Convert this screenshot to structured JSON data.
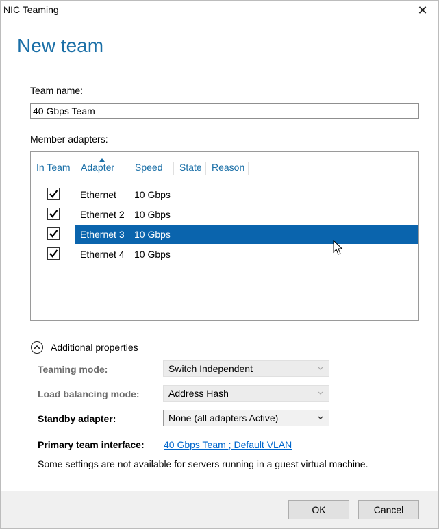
{
  "window": {
    "title": "NIC Teaming",
    "close_symbol": "✕"
  },
  "heading": "New team",
  "team_name": {
    "label": "Team name:",
    "value": "40 Gbps Team"
  },
  "member_adapters": {
    "label": "Member adapters:",
    "columns": [
      "In Team",
      "Adapter",
      "Speed",
      "State",
      "Reason"
    ],
    "sorted_column": "Adapter",
    "rows": [
      {
        "in_team": true,
        "adapter": "Ethernet",
        "speed": "10 Gbps",
        "state": "",
        "reason": "",
        "selected": false
      },
      {
        "in_team": true,
        "adapter": "Ethernet 2",
        "speed": "10 Gbps",
        "state": "",
        "reason": "",
        "selected": false
      },
      {
        "in_team": true,
        "adapter": "Ethernet 3",
        "speed": "10 Gbps",
        "state": "",
        "reason": "",
        "selected": true
      },
      {
        "in_team": true,
        "adapter": "Ethernet 4",
        "speed": "10 Gbps",
        "state": "",
        "reason": "",
        "selected": false
      }
    ]
  },
  "additional_properties": {
    "label": "Additional properties",
    "expanded": true,
    "teaming_mode": {
      "label": "Teaming mode:",
      "value": "Switch Independent",
      "enabled": false
    },
    "load_balancing_mode": {
      "label": "Load balancing mode:",
      "value": "Address Hash",
      "enabled": false
    },
    "standby_adapter": {
      "label": "Standby adapter:",
      "value": "None (all adapters Active)",
      "enabled": true
    },
    "primary_team_interface": {
      "label": "Primary team interface:",
      "link": "40 Gbps Team ; Default VLAN"
    },
    "note": "Some settings are not available for servers running in a guest virtual machine."
  },
  "buttons": {
    "ok": "OK",
    "cancel": "Cancel"
  },
  "colors": {
    "accent": "#1a6fa7",
    "selection": "#0a64ad",
    "link": "#0066cc"
  }
}
